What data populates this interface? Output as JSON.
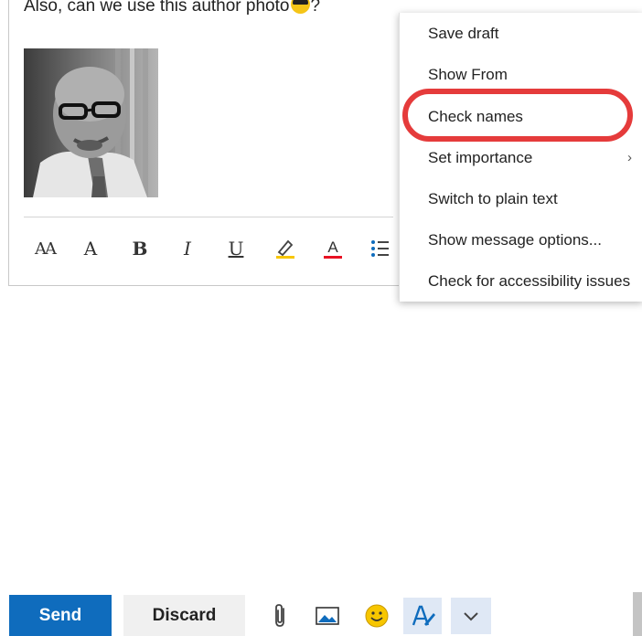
{
  "message": {
    "body_text": "Also, can we use this author photo",
    "body_suffix": "?"
  },
  "format_toolbar": {
    "font_size_label": "AA",
    "grow_font_label": "A",
    "bold_label": "B",
    "italic_label": "I",
    "underline_label": "U",
    "font_color_label": "A",
    "highlight_color": "#f7c600",
    "font_color": "#e81123"
  },
  "actions": {
    "send_label": "Send",
    "discard_label": "Discard"
  },
  "icons": [
    "attach-icon",
    "image-icon",
    "emoji-icon",
    "editor-icon",
    "chevron-down-icon"
  ],
  "more_menu": {
    "items": [
      {
        "label": "Save draft"
      },
      {
        "label": "Show From"
      },
      {
        "label": "Check names"
      },
      {
        "label": "Set importance",
        "submenu_glyph": "›"
      },
      {
        "label": "Switch to plain text"
      },
      {
        "label": "Show message options..."
      },
      {
        "label": "Check for accessibility issues"
      }
    ]
  },
  "colors": {
    "accent": "#0f6cbd",
    "highlight_ring": "#e53b3b",
    "active_button_bg": "#dfe8f5"
  }
}
